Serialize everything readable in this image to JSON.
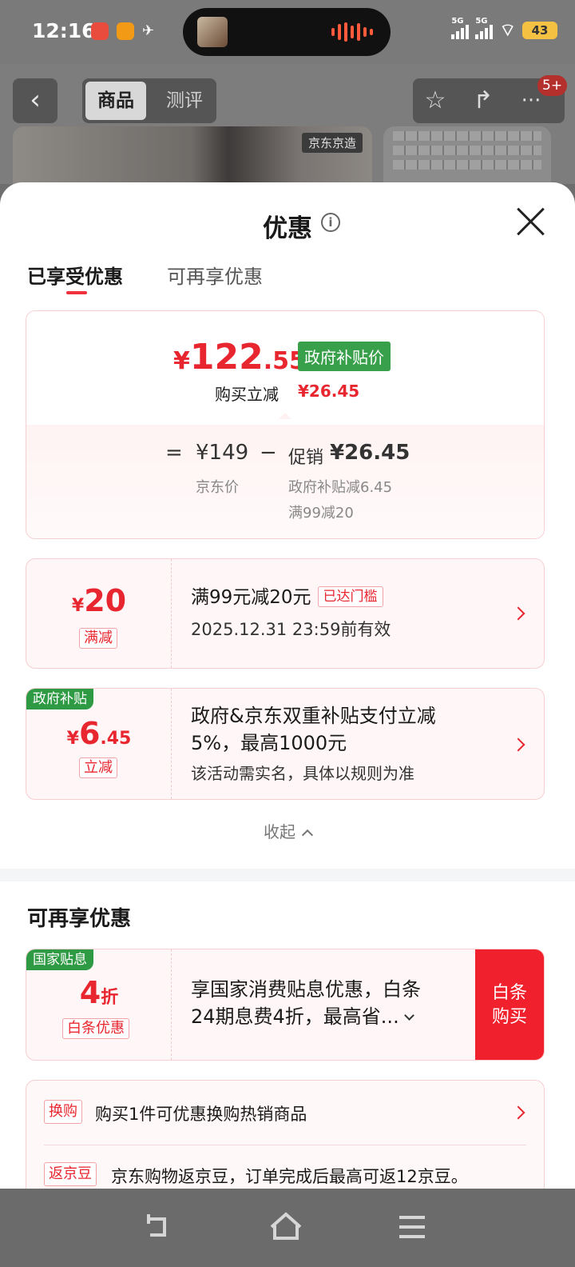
{
  "status_bar": {
    "time": "12:16",
    "signal1": "5G",
    "signal2": "5G",
    "battery": "43"
  },
  "nav": {
    "tab_product": "商品",
    "tab_review": "测评",
    "badge": "5+",
    "image_tag": "京东京造"
  },
  "sheet": {
    "title": "优惠",
    "tabs": {
      "enjoyed": "已享受优惠",
      "more": "可再享优惠"
    },
    "summary": {
      "currency": "¥",
      "price_int": "122",
      "price_dec": ".55",
      "gov_price_tag": "政府补贴价",
      "instant_label": "购买立减",
      "instant_value": "¥26.45",
      "eq": "=",
      "jd_price": "¥149",
      "jd_price_label": "京东价",
      "minus": "−",
      "promo_label": "促销",
      "promo_value": "¥26.45",
      "promo_detail_1": "政府补贴减6.45",
      "promo_detail_2": "满99减20"
    },
    "coupons": [
      {
        "currency": "¥",
        "amount": "20",
        "type": "满减",
        "title": "满99元减20元",
        "status": "已达门槛",
        "validity": "2025.12.31 23:59前有效"
      },
      {
        "corner": "政府补贴",
        "currency": "¥",
        "amount": "6",
        "amount_dec": ".45",
        "type": "立减",
        "title_line1": "政府&京东双重补贴支付立减",
        "title_line2": "5%，最高1000元",
        "note": "该活动需实名，具体以规则为准"
      }
    ],
    "collapse": "收起",
    "more_section_title": "可再享优惠",
    "baitiao": {
      "corner": "国家贴息",
      "amount": "4",
      "unit": "折",
      "type": "白条优惠",
      "text_line1": "享国家消费贴息优惠，白条",
      "text_line2": "24期息费4折，最高省...",
      "buy_line1": "白条",
      "buy_line2": "购买"
    },
    "extras": [
      {
        "tag": "换购",
        "text": "购买1件可优惠换购热销商品"
      },
      {
        "tag": "返京豆",
        "text": "京东购物返京豆，订单完成后最高可返12京豆。"
      }
    ]
  }
}
